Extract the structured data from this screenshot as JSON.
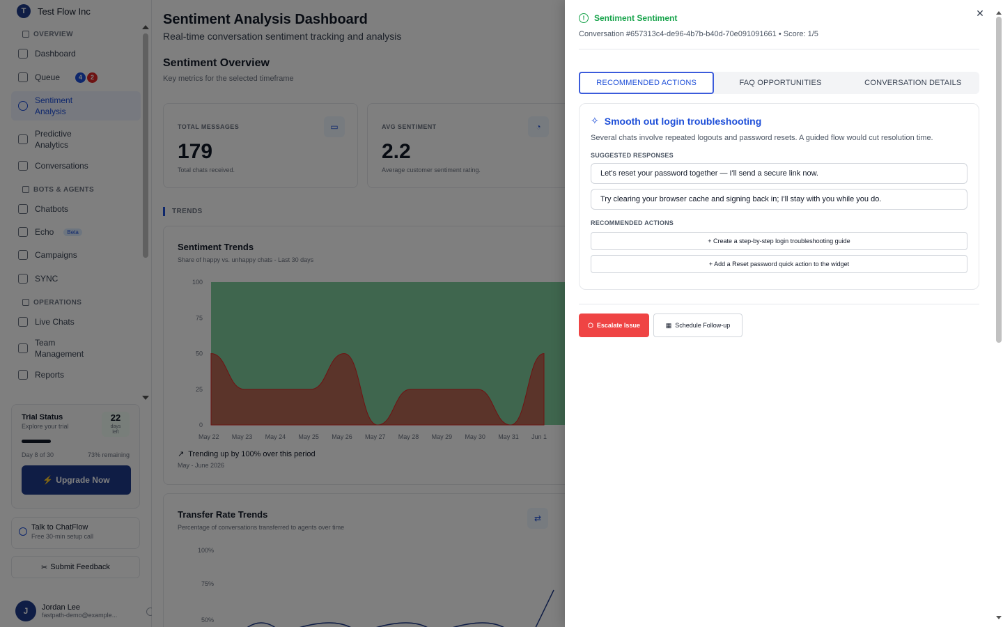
{
  "org": {
    "initial": "T",
    "name": "Test Flow Inc"
  },
  "sidebar": {
    "overview_heading": "OVERVIEW",
    "dashboard": "Dashboard",
    "queue": "Queue",
    "queue_badge_blue": "4",
    "queue_badge_red": "2",
    "sentiment_line1": "Sentiment",
    "sentiment_line2": "Analysis",
    "predictive_line1": "Predictive",
    "predictive_line2": "Analytics",
    "conversations": "Conversations",
    "bots_heading": "BOTS & AGENTS",
    "chatbots": "Chatbots",
    "echo": "Echo",
    "echo_badge": "Beta",
    "campaigns": "Campaigns",
    "sync": "SYNC",
    "ops_heading": "OPERATIONS",
    "live_chats": "Live Chats",
    "team_line1": "Team",
    "team_line2": "Management",
    "reports": "Reports"
  },
  "trial": {
    "title": "Trial Status",
    "subtitle": "Explore your trial",
    "days": "22",
    "days_label1": "days",
    "days_label2": "left",
    "progress_fraction": 0.27,
    "day_text": "Day 8 of 30",
    "remaining_text": "73% remaining",
    "upgrade_label": "Upgrade Now"
  },
  "talk": {
    "title": "Talk to ChatFlow",
    "subtitle": "Free 30-min setup call"
  },
  "feedback_label": "Submit Feedback",
  "user": {
    "initial": "J",
    "name": "Jordan Lee",
    "email": "fastpath-demo@example..."
  },
  "main": {
    "title": "Sentiment Analysis Dashboard",
    "subtitle": "Real-time conversation sentiment tracking and analysis",
    "overview_title": "Sentiment Overview",
    "overview_sub": "Key metrics for the selected timeframe",
    "metrics": [
      {
        "label": "TOTAL MESSAGES",
        "value": "179",
        "caption": "Total chats received."
      },
      {
        "label": "AVG SENTIMENT",
        "value": "2.2",
        "caption": "Average customer sentiment rating."
      }
    ],
    "trends_heading": "TRENDS",
    "sentiment_chart": {
      "title": "Sentiment Trends",
      "subtitle": "Share of happy vs. unhappy chats - Last 30 days",
      "trend_note": "Trending up by 100% over this period",
      "period": "May - June 2026"
    },
    "transfer_chart": {
      "title": "Transfer Rate Trends",
      "subtitle": "Percentage of conversations transferred to agents over time"
    }
  },
  "chart_data": [
    {
      "type": "area",
      "title": "Sentiment Trends",
      "categories": [
        "May 22",
        "May 23",
        "May 24",
        "May 25",
        "May 26",
        "May 27",
        "May 28",
        "May 29",
        "May 30",
        "May 31",
        "Jun 1"
      ],
      "y_ticks": [
        "100",
        "75",
        "50",
        "25",
        "0"
      ],
      "ylim": [
        0,
        100
      ],
      "series": [],
      "unhappy_values": [
        50,
        25,
        25,
        25,
        50,
        0,
        25,
        25,
        25,
        0,
        50
      ],
      "happy_values": [
        50,
        75,
        75,
        75,
        50,
        100,
        75,
        75,
        75,
        100,
        50
      ],
      "colors": {
        "happy": "#16a34a",
        "unhappy": "#dc2626"
      }
    },
    {
      "type": "line",
      "title": "Transfer Rate Trends",
      "y_ticks": [
        "100%",
        "75%",
        "50%"
      ],
      "ylim": [
        0,
        100
      ]
    }
  ],
  "drawer": {
    "title": "Sentiment Sentiment",
    "subtitle": "Conversation #657313c4-de96-4b7b-b40d-70e091091661 • Score: 1/5",
    "tabs": [
      "RECOMMENDED ACTIONS",
      "FAQ OPPORTUNITIES",
      "CONVERSATION DETAILS"
    ],
    "card": {
      "title": "Smooth out login troubleshooting",
      "description": "Several chats involve repeated logouts and password resets. A guided flow would cut resolution time.",
      "responses_heading": "SUGGESTED RESPONSES",
      "responses": [
        "Let's reset your password together — I'll send a secure link now.",
        "Try clearing your browser cache and signing back in; I'll stay with you while you do."
      ],
      "actions_heading": "RECOMMENDED ACTIONS",
      "actions": [
        "+ Create a step-by-step login troubleshooting guide",
        "+ Add a Reset password quick action to the widget"
      ]
    },
    "escalate_label": "Escalate Issue",
    "followup_label": "Schedule Follow-up",
    "colors": {
      "accent": "#1d4ed8",
      "success": "#16a34a",
      "danger": "#ef4444"
    }
  }
}
